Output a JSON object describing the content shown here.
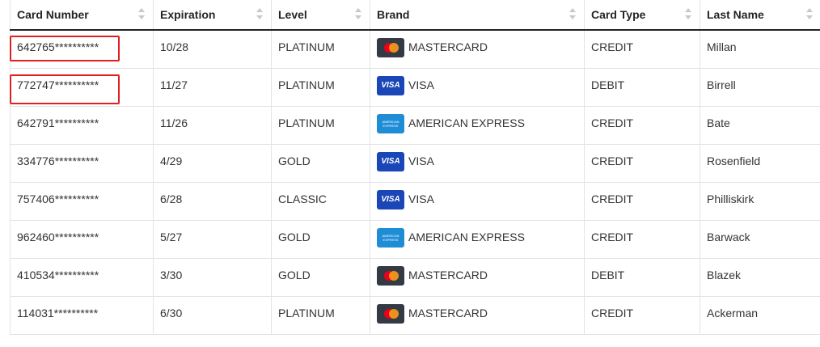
{
  "columns": [
    "Card Number",
    "Expiration",
    "Level",
    "Brand",
    "Card Type",
    "Last Name"
  ],
  "rows": [
    {
      "card": "642765**********",
      "exp": "10/28",
      "level": "PLATINUM",
      "brand": "MASTERCARD",
      "logo": "mastercard-logo",
      "type": "CREDIT",
      "last": "Millan"
    },
    {
      "card": "772747**********",
      "exp": "11/27",
      "level": "PLATINUM",
      "brand": "VISA",
      "logo": "visa-logo",
      "type": "DEBIT",
      "last": "Birrell"
    },
    {
      "card": "642791**********",
      "exp": "11/26",
      "level": "PLATINUM",
      "brand": "AMERICAN EXPRESS",
      "logo": "amex-logo",
      "type": "CREDIT",
      "last": "Bate"
    },
    {
      "card": "334776**********",
      "exp": "4/29",
      "level": "GOLD",
      "brand": "VISA",
      "logo": "visa-logo",
      "type": "CREDIT",
      "last": "Rosenfield"
    },
    {
      "card": "757406**********",
      "exp": "6/28",
      "level": "CLASSIC",
      "brand": "VISA",
      "logo": "visa-logo",
      "type": "CREDIT",
      "last": "Philliskirk"
    },
    {
      "card": "962460**********",
      "exp": "5/27",
      "level": "GOLD",
      "brand": "AMERICAN EXPRESS",
      "logo": "amex-logo",
      "type": "CREDIT",
      "last": "Barwack"
    },
    {
      "card": "410534**********",
      "exp": "3/30",
      "level": "GOLD",
      "brand": "MASTERCARD",
      "logo": "mastercard-logo",
      "type": "DEBIT",
      "last": "Blazek"
    },
    {
      "card": "114031**********",
      "exp": "6/30",
      "level": "PLATINUM",
      "brand": "MASTERCARD",
      "logo": "mastercard-logo",
      "type": "CREDIT",
      "last": "Ackerman"
    }
  ],
  "logo_text": {
    "visa": "VISA",
    "amex": "AMERICAN EXPRESS"
  },
  "colors": {
    "highlight": "#e02020",
    "visa": "#1a46b8",
    "amex": "#1f8dd6",
    "mastercard": "#333a44"
  }
}
